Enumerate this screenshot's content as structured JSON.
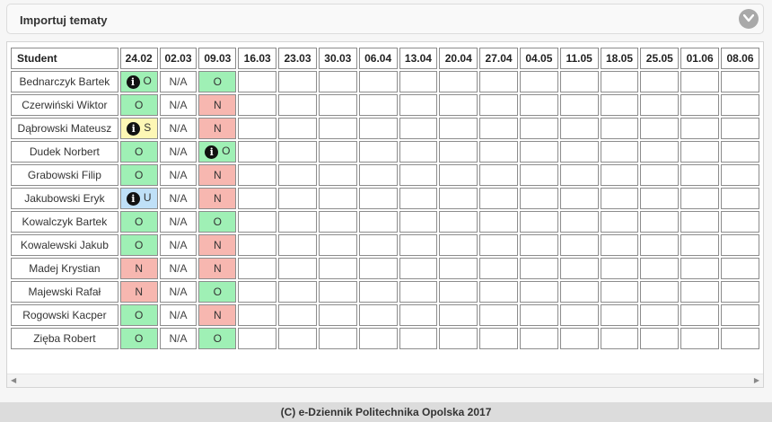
{
  "panel": {
    "title": "Importuj tematy"
  },
  "table": {
    "student_header": "Student",
    "dates": [
      "24.02",
      "02.03",
      "09.03",
      "16.03",
      "23.03",
      "30.03",
      "06.04",
      "13.04",
      "20.04",
      "27.04",
      "04.05",
      "11.05",
      "18.05",
      "25.05",
      "01.06",
      "08.06"
    ],
    "rows": [
      {
        "name": "Bednarczyk Bartek",
        "cells": [
          {
            "v": "O",
            "info": true
          },
          {
            "v": "N/A"
          },
          {
            "v": "O"
          }
        ]
      },
      {
        "name": "Czerwiński Wiktor",
        "cells": [
          {
            "v": "O"
          },
          {
            "v": "N/A"
          },
          {
            "v": "N"
          }
        ]
      },
      {
        "name": "Dąbrowski Mateusz",
        "cells": [
          {
            "v": "S",
            "info": true
          },
          {
            "v": "N/A"
          },
          {
            "v": "N"
          }
        ]
      },
      {
        "name": "Dudek Norbert",
        "cells": [
          {
            "v": "O"
          },
          {
            "v": "N/A"
          },
          {
            "v": "O",
            "info": true
          }
        ]
      },
      {
        "name": "Grabowski Filip",
        "cells": [
          {
            "v": "O"
          },
          {
            "v": "N/A"
          },
          {
            "v": "N"
          }
        ]
      },
      {
        "name": "Jakubowski Eryk",
        "cells": [
          {
            "v": "U",
            "info": true
          },
          {
            "v": "N/A"
          },
          {
            "v": "N"
          }
        ]
      },
      {
        "name": "Kowalczyk Bartek",
        "cells": [
          {
            "v": "O"
          },
          {
            "v": "N/A"
          },
          {
            "v": "O"
          }
        ]
      },
      {
        "name": "Kowalewski Jakub",
        "cells": [
          {
            "v": "O"
          },
          {
            "v": "N/A"
          },
          {
            "v": "N"
          }
        ]
      },
      {
        "name": "Madej Krystian",
        "cells": [
          {
            "v": "N"
          },
          {
            "v": "N/A"
          },
          {
            "v": "N"
          }
        ]
      },
      {
        "name": "Majewski Rafał",
        "cells": [
          {
            "v": "N"
          },
          {
            "v": "N/A"
          },
          {
            "v": "O"
          }
        ]
      },
      {
        "name": "Rogowski Kacper",
        "cells": [
          {
            "v": "O"
          },
          {
            "v": "N/A"
          },
          {
            "v": "N"
          }
        ]
      },
      {
        "name": "Zięba Robert",
        "cells": [
          {
            "v": "O"
          },
          {
            "v": "N/A"
          },
          {
            "v": "O"
          }
        ]
      }
    ]
  },
  "status_colors": {
    "O": "#9ff0b5",
    "N": "#f7b7b0",
    "S": "#fdf7b5",
    "U": "#bfe0f7"
  },
  "icons": {
    "info": "info-icon",
    "collapse": "chevron-down-icon",
    "scroll_left": "arrow-left-icon",
    "scroll_right": "arrow-right-icon"
  },
  "footer": {
    "text": "(C) e-Dziennik Politechnika Opolska 2017"
  }
}
